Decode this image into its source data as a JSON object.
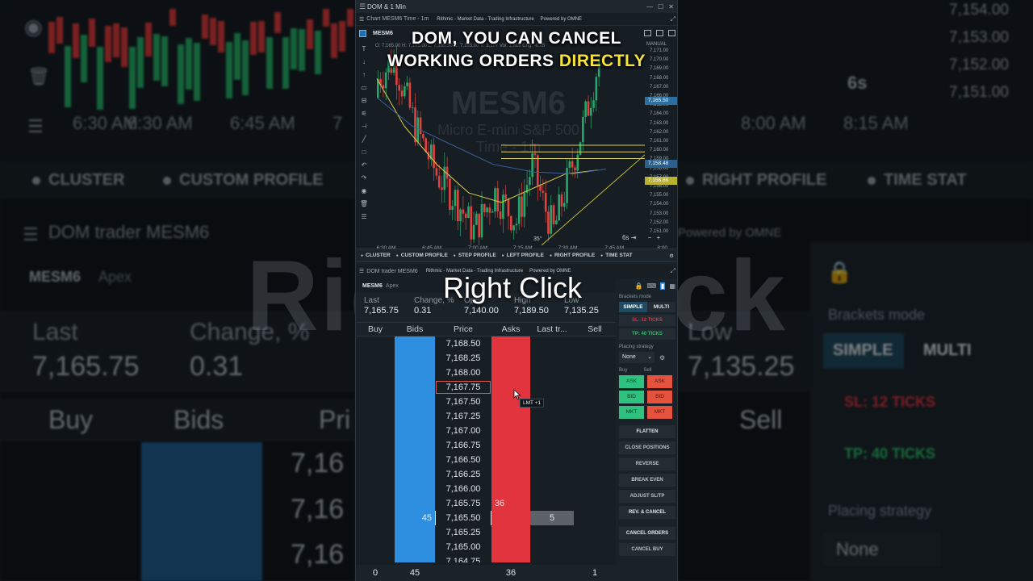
{
  "window": {
    "title": "DOM & 1 Min"
  },
  "chart": {
    "title": "Chart MESM6 Time - 1m",
    "rithmic": "Rithmic - Market Data - Trading Infrastructure",
    "omne": "Powered by OMNE",
    "symbol": "MESM6",
    "ohlc": "O: 7,165.00  H: 7,165.00  L: 7,165.50  C: 7,165.00  V: 3,107  Vol: 1,816  Chg: -0.05",
    "watermark_symbol": "MESM6",
    "watermark_name": "Micro E-mini S&P 500",
    "watermark_tf": "Time - 1m",
    "manual_label": "MANUAL",
    "price_labels": [
      "7,171.00",
      "7,170.00",
      "7,169.00",
      "7,168.00",
      "7,167.00",
      "7,166.00",
      "7,165.00",
      "7,164.00",
      "7,163.00",
      "7,162.00",
      "7,161.00",
      "7,160.00",
      "7,159.00",
      "7,158.00",
      "7,157.00",
      "7,156.00",
      "7,155.00",
      "7,154.00",
      "7,153.00",
      "7,152.00",
      "7,151.00"
    ],
    "price_tags": [
      {
        "text": "7,165.50",
        "price": 7165.5,
        "color": "#2d6f9e"
      },
      {
        "text": "7,158.48",
        "price": 7158.48,
        "color": "#2d5f8c"
      },
      {
        "text": "7,156.66",
        "price": 7156.66,
        "color": "#b8b22e"
      }
    ],
    "time_labels": [
      "6:30 AM",
      "6:45 AM",
      "7:00 AM",
      "7:15 AM",
      "7:30 AM",
      "7:45 AM",
      "8:00 AM",
      "8:15 AM"
    ],
    "interval_label": "6s",
    "marker_label": "35°",
    "tabs": [
      "CLUSTER",
      "CUSTOM PROFILE",
      "STEP PROFILE",
      "LEFT PROFILE",
      "RIGHT PROFILE",
      "TIME STAT"
    ]
  },
  "dom": {
    "title": "DOM trader MESM6",
    "rithmic": "Rithmic - Market Data - Trading Infrastructure",
    "omne": "Powered by OMNE",
    "symbol": "MESM6",
    "account": "Apex",
    "stats": [
      {
        "label": "Last",
        "value": "7,165.75"
      },
      {
        "label": "Change, %",
        "value": "0.31"
      },
      {
        "label": "Open",
        "value": "7,140.00"
      },
      {
        "label": "High",
        "value": "7,189.50"
      },
      {
        "label": "Low",
        "value": "7,135.25"
      }
    ],
    "columns": [
      "Buy",
      "Bids",
      "Price",
      "Asks",
      "Last tr...",
      "Sell"
    ],
    "rows": [
      {
        "price": "7,168.50",
        "bid": "",
        "ask": "",
        "last": ""
      },
      {
        "price": "7,168.25",
        "bid": "",
        "ask": "",
        "last": ""
      },
      {
        "price": "7,168.00",
        "bid": "",
        "ask": "",
        "last": ""
      },
      {
        "price": "7,167.75",
        "bid": "",
        "ask": "",
        "last": "",
        "highlight": true
      },
      {
        "price": "7,167.50",
        "bid": "",
        "ask": "",
        "last": ""
      },
      {
        "price": "7,167.25",
        "bid": "",
        "ask": "",
        "last": ""
      },
      {
        "price": "7,167.00",
        "bid": "",
        "ask": "",
        "last": ""
      },
      {
        "price": "7,166.75",
        "bid": "",
        "ask": "",
        "last": ""
      },
      {
        "price": "7,166.50",
        "bid": "",
        "ask": "",
        "last": ""
      },
      {
        "price": "7,166.25",
        "bid": "",
        "ask": "",
        "last": ""
      },
      {
        "price": "7,166.00",
        "bid": "",
        "ask": "",
        "last": ""
      },
      {
        "price": "7,165.75",
        "bid": "",
        "ask": "36",
        "last": ""
      },
      {
        "price": "7,165.50",
        "bid": "45",
        "ask": "",
        "last": "5",
        "current": true
      },
      {
        "price": "7,165.25",
        "bid": "",
        "ask": "",
        "last": ""
      },
      {
        "price": "7,165.00",
        "bid": "",
        "ask": "",
        "last": ""
      },
      {
        "price": "7,164.75",
        "bid": "",
        "ask": "",
        "last": ""
      }
    ],
    "footer": [
      "0",
      "45",
      "",
      "36",
      "",
      "1"
    ],
    "tooltip": "LMT +1",
    "panel": {
      "brackets_mode_label": "Brackets mode",
      "simple": "SIMPLE",
      "multi": "MULTI",
      "sl": "SL: 12 TICKS",
      "tp": "TP: 40 TICKS",
      "placing_strategy_label": "Placing strategy",
      "placing_strategy_value": "None",
      "buy_label": "Buy",
      "sell_label": "Sell",
      "buy_buttons": [
        "ASK",
        "BID",
        "MKT"
      ],
      "sell_buttons": [
        "ASK",
        "BID",
        "MKT"
      ],
      "actions": [
        "FLATTEN",
        "CLOSE POSITIONS",
        "REVERSE",
        "BREAK EVEN",
        "ADJUST SL/TP",
        "REV. & CANCEL",
        "CANCEL ORDERS",
        "CANCEL BUY"
      ]
    }
  },
  "overlay": {
    "caption_line1": "DOM, YOU CAN CANCEL",
    "caption_line2_a": "WORKING ORDERS ",
    "caption_line2_b": "DIRECTLY",
    "caption_sub": "Right Click",
    "background_text": "Right Click"
  },
  "background": {
    "left_times": [
      "6:30 AM",
      "6:45 AM",
      "7"
    ],
    "left_tabs": [
      "CLUSTER",
      "CUSTOM PROFILE"
    ],
    "left_dom_title": "DOM trader MESM6",
    "left_symbol": "MESM6",
    "left_account": "Apex",
    "left_stats": [
      {
        "label": "Last",
        "value": "7,165.75"
      },
      {
        "label": "Change, %",
        "value": "0.31"
      }
    ],
    "left_cols": [
      "Buy",
      "Bids",
      "Pri"
    ],
    "left_prices": [
      "7,16",
      "7,16",
      "7,16"
    ],
    "right_prices": [
      "7,154.00",
      "7,153.00",
      "7,152.00",
      "7,151.00"
    ],
    "right_times": [
      "8:00 AM",
      "8:15 AM"
    ],
    "right_interval": "6s",
    "right_tabs": [
      "RIGHT PROFILE",
      "TIME STAT"
    ],
    "right_omne": "Powered by OMNE",
    "right_low_label": "Low",
    "right_low_value": "7,135.25",
    "right_brackets": "Brackets mode",
    "right_simple": "SIMPLE",
    "right_multi": "MULTI",
    "right_sl": "SL: 12 TICKS",
    "right_tp": "TP: 40 TICKS",
    "right_sell": "Sell",
    "right_placing": "Placing strategy",
    "right_none": "None"
  }
}
